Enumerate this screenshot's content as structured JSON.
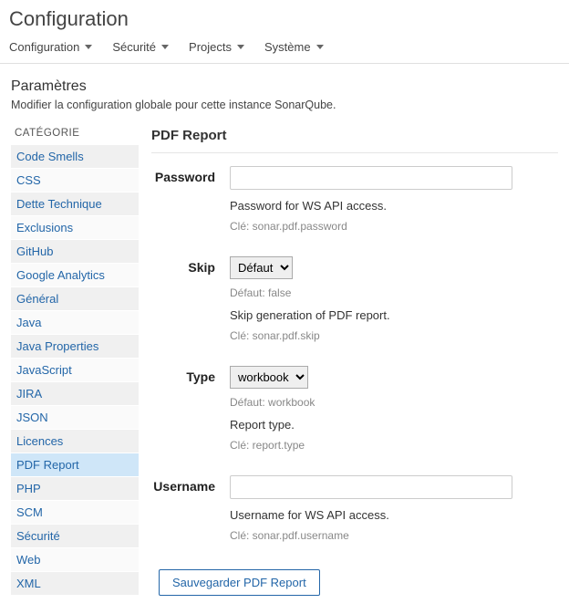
{
  "page_title": "Configuration",
  "topnav": [
    {
      "label": "Configuration"
    },
    {
      "label": "Sécurité"
    },
    {
      "label": "Projects"
    },
    {
      "label": "Système"
    }
  ],
  "sub": {
    "title": "Paramètres",
    "desc": "Modifier la configuration globale pour cette instance SonarQube."
  },
  "sidebar": {
    "title": "CATÉGORIE",
    "items": [
      {
        "label": "Code Smells",
        "selected": false
      },
      {
        "label": "CSS",
        "selected": false
      },
      {
        "label": "Dette Technique",
        "selected": false
      },
      {
        "label": "Exclusions",
        "selected": false
      },
      {
        "label": "GitHub",
        "selected": false
      },
      {
        "label": "Google Analytics",
        "selected": false
      },
      {
        "label": "Général",
        "selected": false
      },
      {
        "label": "Java",
        "selected": false
      },
      {
        "label": "Java Properties",
        "selected": false
      },
      {
        "label": "JavaScript",
        "selected": false
      },
      {
        "label": "JIRA",
        "selected": false
      },
      {
        "label": "JSON",
        "selected": false
      },
      {
        "label": "Licences",
        "selected": false
      },
      {
        "label": "PDF Report",
        "selected": true
      },
      {
        "label": "PHP",
        "selected": false
      },
      {
        "label": "SCM",
        "selected": false
      },
      {
        "label": "Sécurité",
        "selected": false
      },
      {
        "label": "Web",
        "selected": false
      },
      {
        "label": "XML",
        "selected": false
      }
    ]
  },
  "section": {
    "title": "PDF Report",
    "fields": {
      "password": {
        "label": "Password",
        "value": "",
        "help": "Password for WS API access.",
        "key": "Clé: sonar.pdf.password"
      },
      "skip": {
        "label": "Skip",
        "selected": "Défaut",
        "default_line": "Défaut: false",
        "help": "Skip generation of PDF report.",
        "key": "Clé: sonar.pdf.skip"
      },
      "type": {
        "label": "Type",
        "selected": "workbook",
        "default_line": "Défaut: workbook",
        "help": "Report type.",
        "key": "Clé: report.type"
      },
      "username": {
        "label": "Username",
        "value": "",
        "help": "Username for WS API access.",
        "key": "Clé: sonar.pdf.username"
      }
    },
    "save_label": "Sauvegarder PDF Report"
  }
}
